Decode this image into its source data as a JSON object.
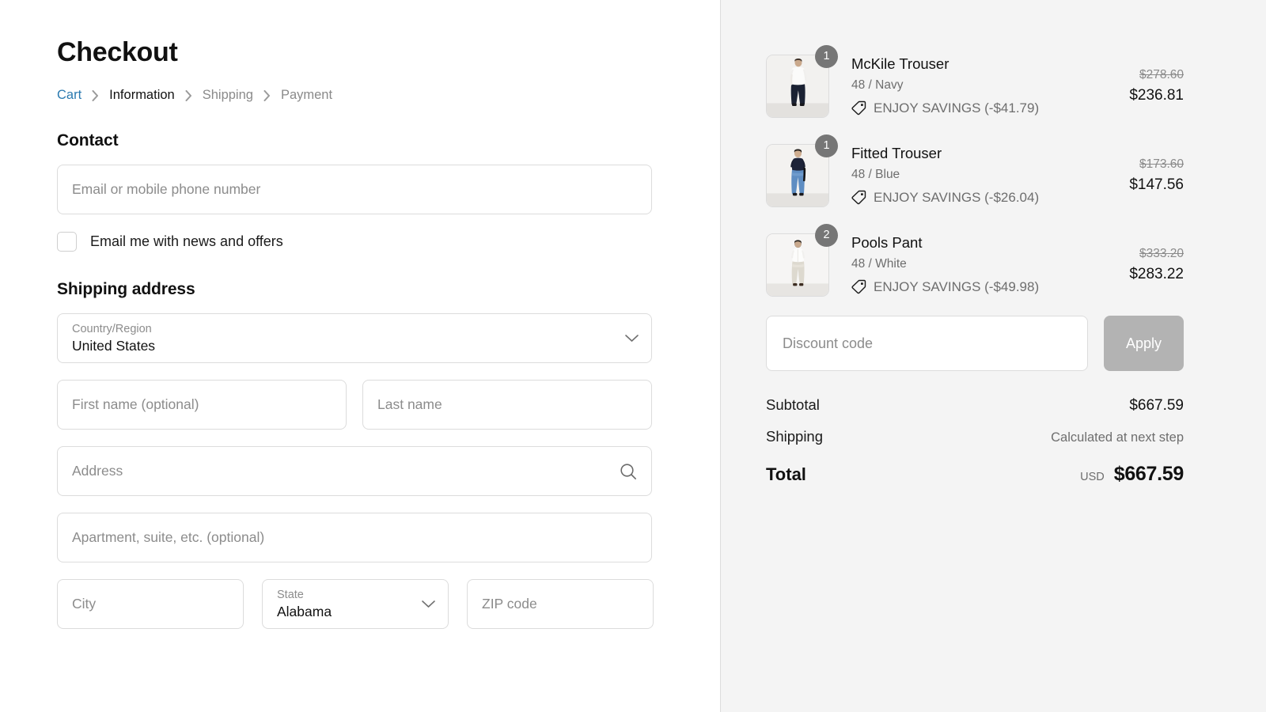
{
  "page": {
    "title": "Checkout"
  },
  "breadcrumb": {
    "separator_icon": "chevron-right-icon",
    "items": [
      {
        "label": "Cart",
        "state": "link"
      },
      {
        "label": "Information",
        "state": "current"
      },
      {
        "label": "Shipping",
        "state": "muted"
      },
      {
        "label": "Payment",
        "state": "muted"
      }
    ]
  },
  "contact": {
    "heading": "Contact",
    "email_placeholder": "Email or mobile phone number",
    "email_value": "",
    "newsletter_label": "Email me with news and offers",
    "newsletter_checked": false
  },
  "shipping_address": {
    "heading": "Shipping address",
    "country": {
      "label": "Country/Region",
      "value": "United States",
      "icon": "chevron-down-icon"
    },
    "first_name_placeholder": "First name (optional)",
    "first_name_value": "",
    "last_name_placeholder": "Last name",
    "last_name_value": "",
    "address_placeholder": "Address",
    "address_value": "",
    "address_icon": "search-icon",
    "apartment_placeholder": "Apartment, suite, etc. (optional)",
    "apartment_value": "",
    "city_placeholder": "City",
    "city_value": "",
    "state": {
      "label": "State",
      "value": "Alabama",
      "icon": "chevron-down-icon"
    },
    "zip_placeholder": "ZIP code",
    "zip_value": ""
  },
  "order_summary": {
    "discount_tag_icon": "tag-icon",
    "items": [
      {
        "name": "McKile Trouser",
        "variant": "48 / Navy",
        "quantity": "1",
        "discount_label": "ENJOY SAVINGS (-$41.79)",
        "price_original": "$278.60",
        "price_current": "$236.81",
        "thumbnail": "man-back-white-shirt-navy-trousers"
      },
      {
        "name": "Fitted Trouser",
        "variant": "48 / Blue",
        "quantity": "1",
        "discount_label": "ENJOY SAVINGS (-$26.04)",
        "price_original": "$173.60",
        "price_current": "$147.56",
        "thumbnail": "man-navy-tee-blue-jeans"
      },
      {
        "name": "Pools Pant",
        "variant": "48 / White",
        "quantity": "2",
        "discount_label": "ENJOY SAVINGS (-$49.98)",
        "price_original": "$333.20",
        "price_current": "$283.22",
        "thumbnail": "man-white-shirt-light-pants"
      }
    ],
    "discount": {
      "placeholder": "Discount code",
      "value": "",
      "apply_label": "Apply"
    },
    "totals": {
      "subtotal_label": "Subtotal",
      "subtotal_value": "$667.59",
      "shipping_label": "Shipping",
      "shipping_value": "Calculated at next step",
      "total_label": "Total",
      "total_currency": "USD",
      "total_value": "$667.59"
    }
  },
  "colors": {
    "link": "#2a7ab0",
    "summary_bg": "#f4f4f4",
    "badge_bg": "#767676",
    "apply_bg": "#b3b3b3",
    "border": "#dcdcdc"
  }
}
